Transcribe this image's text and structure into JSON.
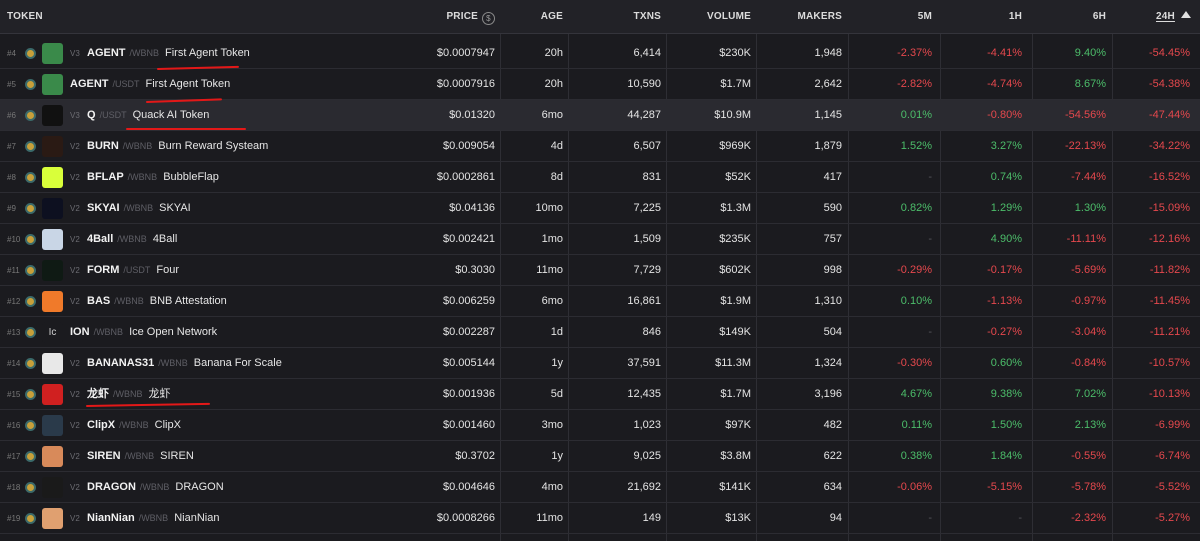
{
  "header": {
    "token": "TOKEN",
    "price": "PRICE",
    "price_icon": "$",
    "age": "AGE",
    "txns": "TXNS",
    "volume": "VOLUME",
    "makers": "MAKERS",
    "m5": "5M",
    "h1": "1H",
    "h6": "6H",
    "h24": "24H",
    "sort_icon": "sort-descending-icon"
  },
  "colors": {
    "positive": "#4cbd6a",
    "negative": "#e5484d",
    "annotation": "#e31818"
  },
  "rows": [
    {
      "rank": "#4",
      "ver": "V3",
      "symbol": "AGENT",
      "quote": "/WBNB",
      "name": "First Agent Token",
      "price": "$0.0007947",
      "age": "20h",
      "txns": "6,414",
      "volume": "$230K",
      "makers": "1,948",
      "m5": "-2.37%",
      "h1": "-4.41%",
      "h6": "9.40%",
      "h24": "-54.45%",
      "logo_icon": "agent-logo-icon",
      "logo_color": "#3a8a4a"
    },
    {
      "rank": "#5",
      "ver": "",
      "symbol": "AGENT",
      "quote": "/USDT",
      "name": "First Agent Token",
      "price": "$0.0007916",
      "age": "20h",
      "txns": "10,590",
      "volume": "$1.7M",
      "makers": "2,642",
      "m5": "-2.82%",
      "h1": "-4.74%",
      "h6": "8.67%",
      "h24": "-54.38%",
      "logo_icon": "agent-logo-icon",
      "logo_color": "#3a8a4a"
    },
    {
      "rank": "#6",
      "ver": "V3",
      "symbol": "Q",
      "quote": "/USDT",
      "name": "Quack AI Token",
      "price": "$0.01320",
      "age": "6mo",
      "txns": "44,287",
      "volume": "$10.9M",
      "makers": "1,145",
      "m5": "0.01%",
      "h1": "-0.80%",
      "h6": "-54.56%",
      "h24": "-47.44%",
      "logo_icon": "quack-logo-icon",
      "logo_color": "#111111"
    },
    {
      "rank": "#7",
      "ver": "V2",
      "symbol": "BURN",
      "quote": "/WBNB",
      "name": "Burn Reward Systeam",
      "price": "$0.009054",
      "age": "4d",
      "txns": "6,507",
      "volume": "$969K",
      "makers": "1,879",
      "m5": "1.52%",
      "h1": "3.27%",
      "h6": "-22.13%",
      "h24": "-34.22%",
      "logo_icon": "fire-logo-icon",
      "logo_color": "#2a1a14"
    },
    {
      "rank": "#8",
      "ver": "V2",
      "symbol": "BFLAP",
      "quote": "/WBNB",
      "name": "BubbleFlap",
      "price": "$0.0002861",
      "age": "8d",
      "txns": "831",
      "volume": "$52K",
      "makers": "417",
      "m5": "-",
      "h1": "0.74%",
      "h6": "-7.44%",
      "h24": "-16.52%",
      "logo_icon": "butterfly-logo-icon",
      "logo_color": "#d9ff3a"
    },
    {
      "rank": "#9",
      "ver": "V2",
      "symbol": "SKYAI",
      "quote": "/WBNB",
      "name": "SKYAI",
      "price": "$0.04136",
      "age": "10mo",
      "txns": "7,225",
      "volume": "$1.3M",
      "makers": "590",
      "m5": "0.82%",
      "h1": "1.29%",
      "h6": "1.30%",
      "h24": "-15.09%",
      "logo_icon": "skyai-logo-icon",
      "logo_color": "#0d1020"
    },
    {
      "rank": "#10",
      "ver": "V2",
      "symbol": "4Ball",
      "quote": "/WBNB",
      "name": "4Ball",
      "price": "$0.002421",
      "age": "1mo",
      "txns": "1,509",
      "volume": "$235K",
      "makers": "757",
      "m5": "-",
      "h1": "4.90%",
      "h6": "-11.11%",
      "h24": "-12.16%",
      "logo_icon": "ball-logo-icon",
      "logo_color": "#c9d6e6"
    },
    {
      "rank": "#11",
      "ver": "V2",
      "symbol": "FORM",
      "quote": "/USDT",
      "name": "Four",
      "price": "$0.3030",
      "age": "11mo",
      "txns": "7,729",
      "volume": "$602K",
      "makers": "998",
      "m5": "-0.29%",
      "h1": "-0.17%",
      "h6": "-5.69%",
      "h24": "-11.82%",
      "logo_icon": "form-logo-icon",
      "logo_color": "#0f1a14"
    },
    {
      "rank": "#12",
      "ver": "V2",
      "symbol": "BAS",
      "quote": "/WBNB",
      "name": "BNB Attestation",
      "price": "$0.006259",
      "age": "6mo",
      "txns": "16,861",
      "volume": "$1.9M",
      "makers": "1,310",
      "m5": "0.10%",
      "h1": "-1.13%",
      "h6": "-0.97%",
      "h24": "-11.45%",
      "logo_icon": "bas-logo-icon",
      "logo_color": "#f07a2a"
    },
    {
      "rank": "#13",
      "ver": "",
      "symbol": "ION",
      "quote": "/WBNB",
      "name": "Ice Open Network",
      "price": "$0.002287",
      "age": "1d",
      "txns": "846",
      "volume": "$149K",
      "makers": "504",
      "m5": "-",
      "h1": "-0.27%",
      "h6": "-3.04%",
      "h24": "-11.21%",
      "logo_icon": "broken-image-icon",
      "logo_color": "#1b1b1f",
      "logo_alt": "Ic"
    },
    {
      "rank": "#14",
      "ver": "V2",
      "symbol": "BANANAS31",
      "quote": "/WBNB",
      "name": "Banana For Scale",
      "price": "$0.005144",
      "age": "1y",
      "txns": "37,591",
      "volume": "$11.3M",
      "makers": "1,324",
      "m5": "-0.30%",
      "h1": "0.60%",
      "h6": "-0.84%",
      "h24": "-10.57%",
      "logo_icon": "banana-logo-icon",
      "logo_color": "#e8e8e8"
    },
    {
      "rank": "#15",
      "ver": "V2",
      "symbol": "龙虾",
      "quote": "/WBNB",
      "name": "龙虾",
      "price": "$0.001936",
      "age": "5d",
      "txns": "12,435",
      "volume": "$1.7M",
      "makers": "3,196",
      "m5": "4.67%",
      "h1": "9.38%",
      "h6": "7.02%",
      "h24": "-10.13%",
      "logo_icon": "lobster-logo-icon",
      "logo_color": "#d02020"
    },
    {
      "rank": "#16",
      "ver": "V2",
      "symbol": "ClipX",
      "quote": "/WBNB",
      "name": "ClipX",
      "price": "$0.001460",
      "age": "3mo",
      "txns": "1,023",
      "volume": "$97K",
      "makers": "482",
      "m5": "0.11%",
      "h1": "1.50%",
      "h6": "2.13%",
      "h24": "-6.99%",
      "logo_icon": "clipx-logo-icon",
      "logo_color": "#2a3a4a"
    },
    {
      "rank": "#17",
      "ver": "V2",
      "symbol": "SIREN",
      "quote": "/WBNB",
      "name": "SIREN",
      "price": "$0.3702",
      "age": "1y",
      "txns": "9,025",
      "volume": "$3.8M",
      "makers": "622",
      "m5": "0.38%",
      "h1": "1.84%",
      "h6": "-0.55%",
      "h24": "-6.74%",
      "logo_icon": "siren-logo-icon",
      "logo_color": "#d88a5a"
    },
    {
      "rank": "#18",
      "ver": "V2",
      "symbol": "DRAGON",
      "quote": "/WBNB",
      "name": "DRAGON",
      "price": "$0.004646",
      "age": "4mo",
      "txns": "21,692",
      "volume": "$141K",
      "makers": "634",
      "m5": "-0.06%",
      "h1": "-5.15%",
      "h6": "-5.78%",
      "h24": "-5.52%",
      "logo_icon": "dragon-logo-icon",
      "logo_color": "#1a1a1a"
    },
    {
      "rank": "#19",
      "ver": "V2",
      "symbol": "NianNian",
      "quote": "/WBNB",
      "name": "NianNian",
      "price": "$0.0008266",
      "age": "11mo",
      "txns": "149",
      "volume": "$13K",
      "makers": "94",
      "m5": "-",
      "h1": "-",
      "h6": "-2.32%",
      "h24": "-5.27%",
      "logo_icon": "niannian-logo-icon",
      "logo_color": "#e0a070"
    }
  ]
}
